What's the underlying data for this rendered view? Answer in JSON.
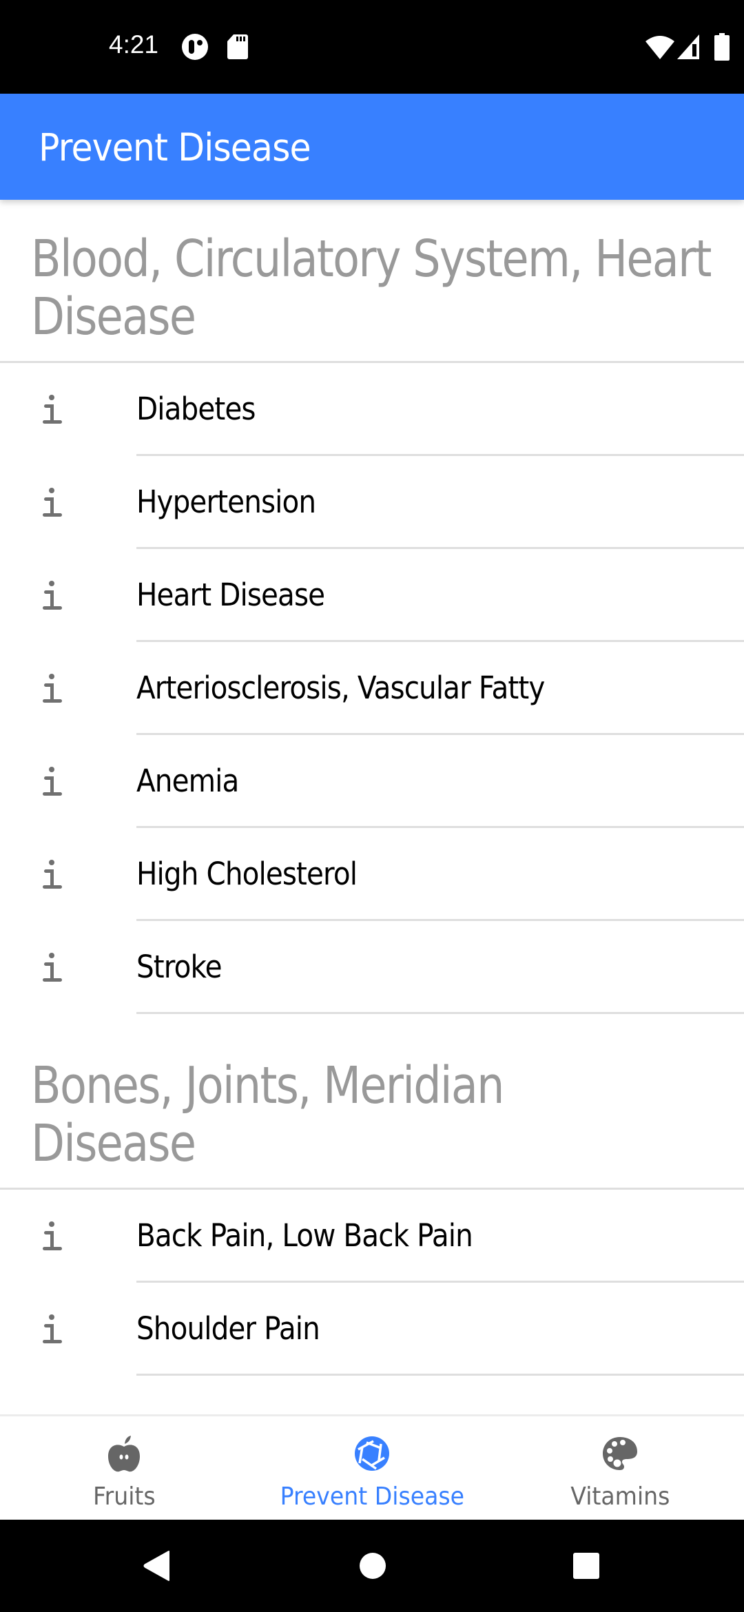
{
  "status_bar": {
    "time": "4:21",
    "left_icons": [
      "data-saver-icon",
      "sd-card-icon"
    ],
    "right_icons": [
      "wifi-icon",
      "cell-signal-icon",
      "battery-icon"
    ]
  },
  "app_bar": {
    "title": "Prevent Disease",
    "background_color": "#3880ff"
  },
  "sections": [
    {
      "title": "Blood, Circulatory System, Heart Disease",
      "items": [
        {
          "icon": "info-icon",
          "label": "Diabetes"
        },
        {
          "icon": "info-icon",
          "label": "Hypertension"
        },
        {
          "icon": "info-icon",
          "label": "Heart Disease"
        },
        {
          "icon": "info-icon",
          "label": "Arteriosclerosis, Vascular Fatty"
        },
        {
          "icon": "info-icon",
          "label": "Anemia"
        },
        {
          "icon": "info-icon",
          "label": "High Cholesterol"
        },
        {
          "icon": "info-icon",
          "label": "Stroke"
        }
      ]
    },
    {
      "title": "Bones, Joints, Meridian Disease",
      "items": [
        {
          "icon": "info-icon",
          "label": "Back Pain, Low Back Pain"
        },
        {
          "icon": "info-icon",
          "label": "Shoulder Pain"
        }
      ]
    }
  ],
  "tab_bar": {
    "active_color": "#3880ff",
    "inactive_color": "#666666",
    "tabs": [
      {
        "label": "Fruits",
        "icon": "apple-icon",
        "active": false
      },
      {
        "label": "Prevent Disease",
        "icon": "aperture-icon",
        "active": true
      },
      {
        "label": "Vitamins",
        "icon": "palette-icon",
        "active": false
      }
    ]
  },
  "nav_bar": {
    "buttons": [
      "back-icon",
      "home-icon",
      "recents-icon"
    ]
  }
}
